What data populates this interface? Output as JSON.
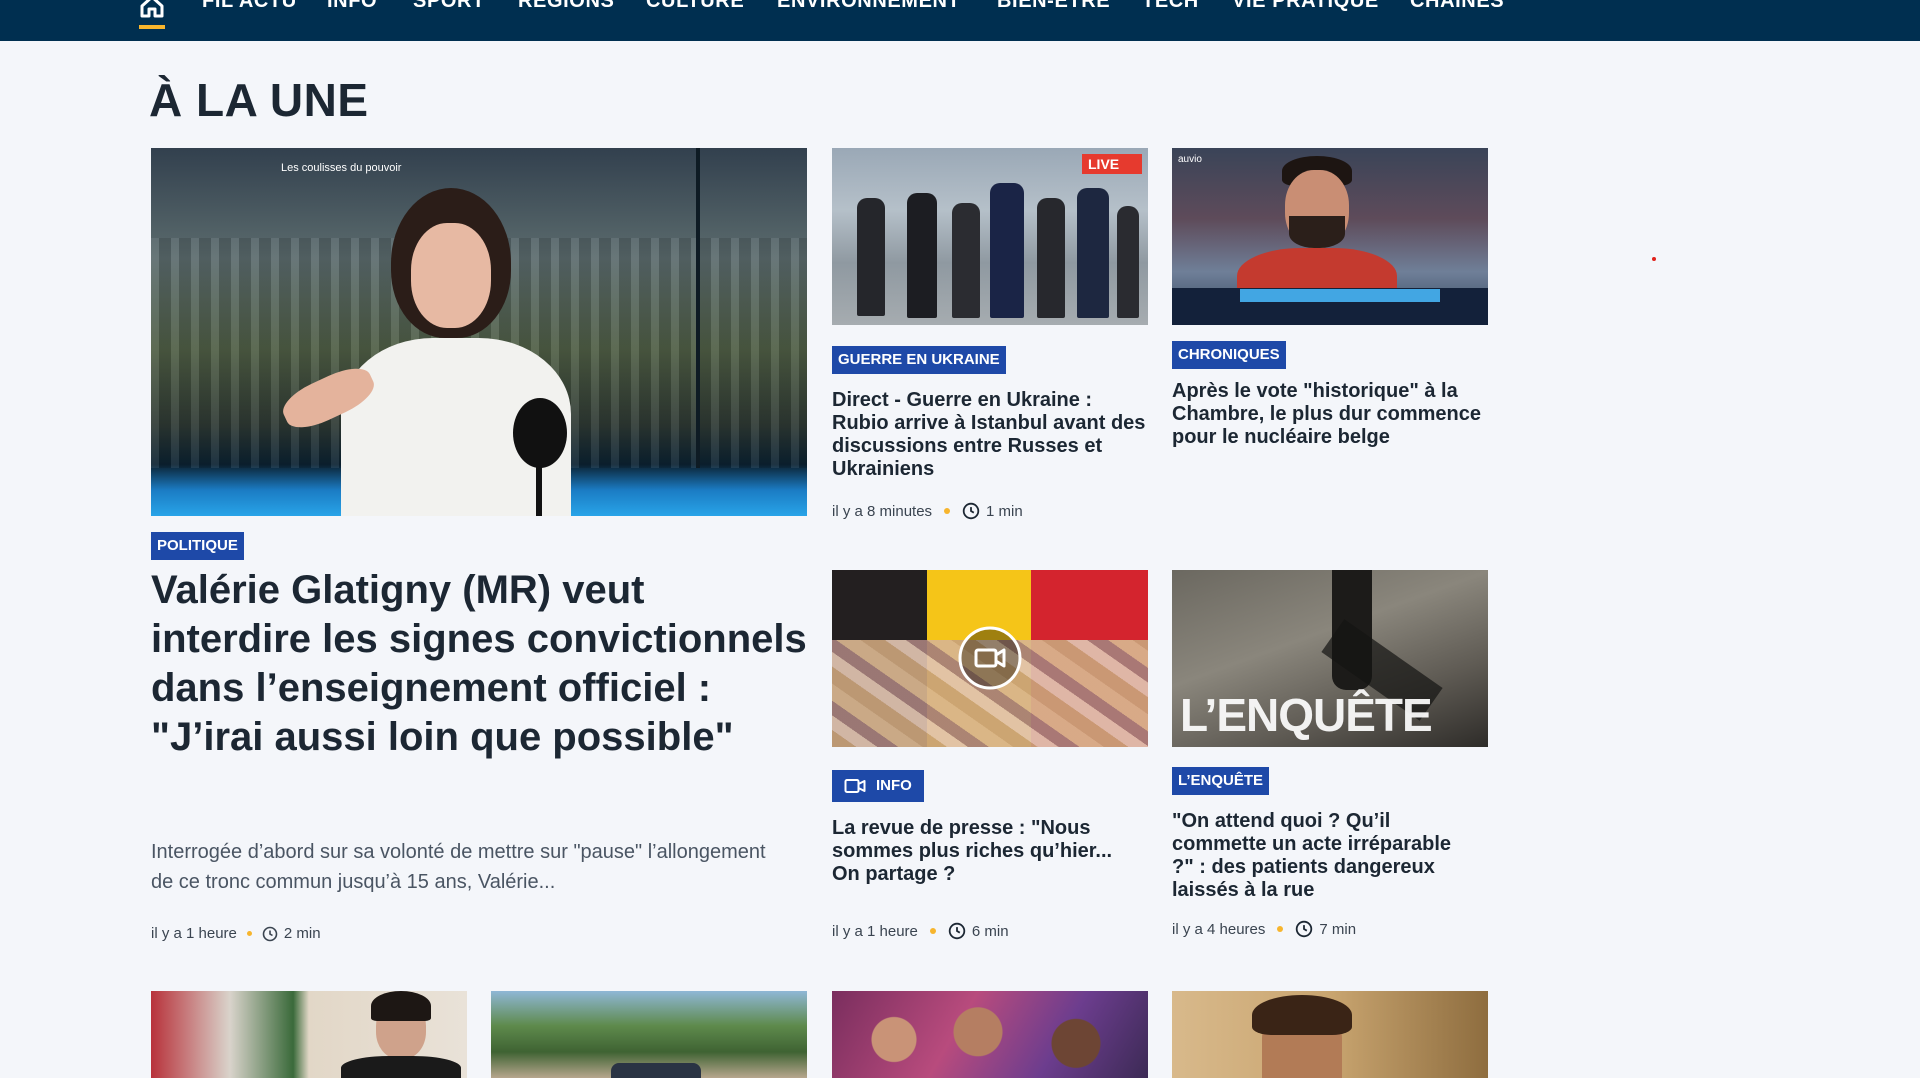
{
  "nav": {
    "items": [
      "FIL ACTU",
      "INFO",
      "SPORT",
      "RÉGIONS",
      "CULTURE",
      "ENVIRONNEMENT",
      "BIEN-ÊTRE",
      "TECH",
      "VIE PRATIQUE",
      "CHAÎNES"
    ],
    "accent": "#f7b52d",
    "background": "#002f50"
  },
  "section": {
    "title": "À LA UNE"
  },
  "tag_color": "#1e49a8",
  "main_article": {
    "image_overlay_text": "Les coulisses du pouvoir",
    "tag": "POLITIQUE",
    "title": "Valérie Glatigny (MR) veut interdire les signes convictionnels dans l’enseignement officiel : \"J’irai aussi loin que possible\"",
    "summary": "Interrogée d’abord sur sa volonté de mettre sur \"pause\" l’allongement de ce tronc commun jusqu’à 15 ans, Valérie...",
    "time": "il y a 1 heure",
    "read": "2 min"
  },
  "articles": [
    {
      "live_badge": "LIVE",
      "tag": "GUERRE EN UKRAINE",
      "title": "Direct - Guerre en Ukraine : Rubio arrive à Istanbul avant des discussions entre Russes et Ukrainiens",
      "time": "il y a 8 minutes",
      "read": "1 min"
    },
    {
      "image_logo_text": "auvio",
      "tag": "CHRONIQUES",
      "title": "Après le vote \"historique\" à la Chambre, le plus dur commence pour le nucléaire belge",
      "time": "",
      "read": ""
    },
    {
      "tag": "INFO",
      "title": "La revue de presse : \"Nous sommes plus riches qu’hier... On partage ?",
      "time": "il y a 1 heure",
      "read": "6 min"
    },
    {
      "image_text": "L’ENQUÊTE",
      "tag": "L’ENQUÊTE",
      "title": "\"On attend quoi ? Qu’il commette un acte irréparable ?\" : des patients dangereux laissés à la rue",
      "time": "il y a 4 heures",
      "read": "7 min"
    }
  ]
}
